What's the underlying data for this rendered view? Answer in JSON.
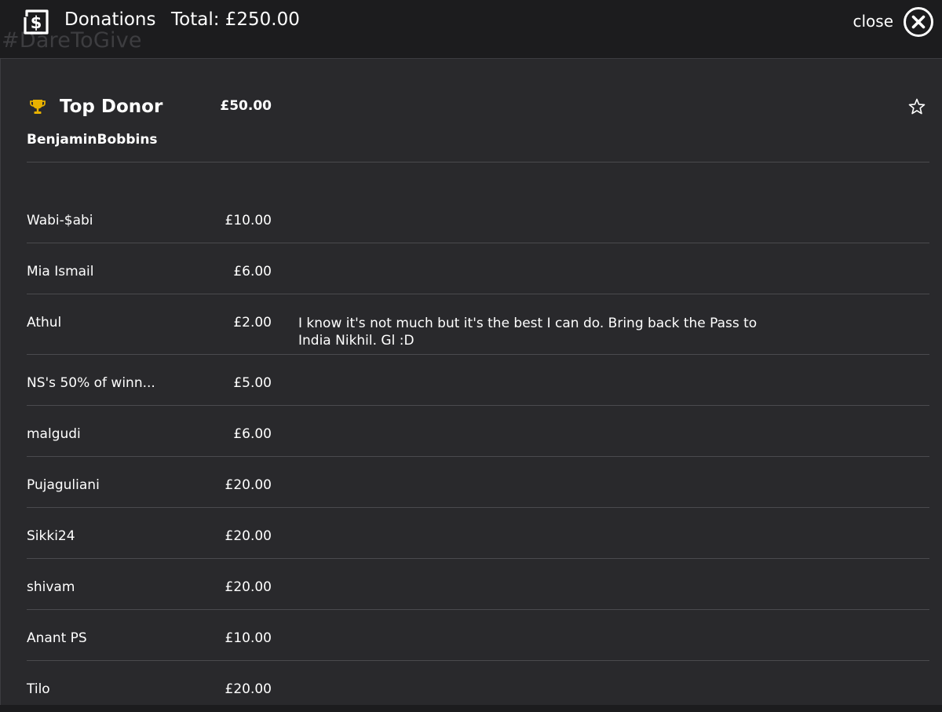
{
  "header": {
    "title": "Donations",
    "total": "Total: £250.00",
    "hashtag": "#DareToGive",
    "close_label": "close"
  },
  "top_donor": {
    "heading": "Top Donor",
    "amount": "£50.00",
    "name": "BenjaminBobbins"
  },
  "donations": [
    {
      "name": "Wabi-$abi",
      "amount": "£10.00",
      "message": ""
    },
    {
      "name": "Mia Ismail",
      "amount": "£6.00",
      "message": ""
    },
    {
      "name": "Athul",
      "amount": "£2.00",
      "message": "I know it's not much but it's the best I can do. Bring back the Pass to India Nikhil. Gl :D"
    },
    {
      "name": "NS's 50% of winn...",
      "amount": "£5.00",
      "message": ""
    },
    {
      "name": "malgudi",
      "amount": "£6.00",
      "message": ""
    },
    {
      "name": "Pujaguliani",
      "amount": "£20.00",
      "message": ""
    },
    {
      "name": "Sikki24",
      "amount": "£20.00",
      "message": ""
    },
    {
      "name": "shivam",
      "amount": "£20.00",
      "message": ""
    },
    {
      "name": "Anant PS",
      "amount": "£10.00",
      "message": ""
    },
    {
      "name": "Tilo",
      "amount": "£20.00",
      "message": ""
    }
  ],
  "colors": {
    "background": "#1c1c1e",
    "panel": "#29292c",
    "divider": "#4a4a4e",
    "trophy": "#e8b100",
    "text": "#ffffff"
  },
  "icons": {
    "app": "dollar-icon",
    "close": "close-circle-icon",
    "trophy": "trophy-icon",
    "favorite": "star-outline-icon"
  }
}
